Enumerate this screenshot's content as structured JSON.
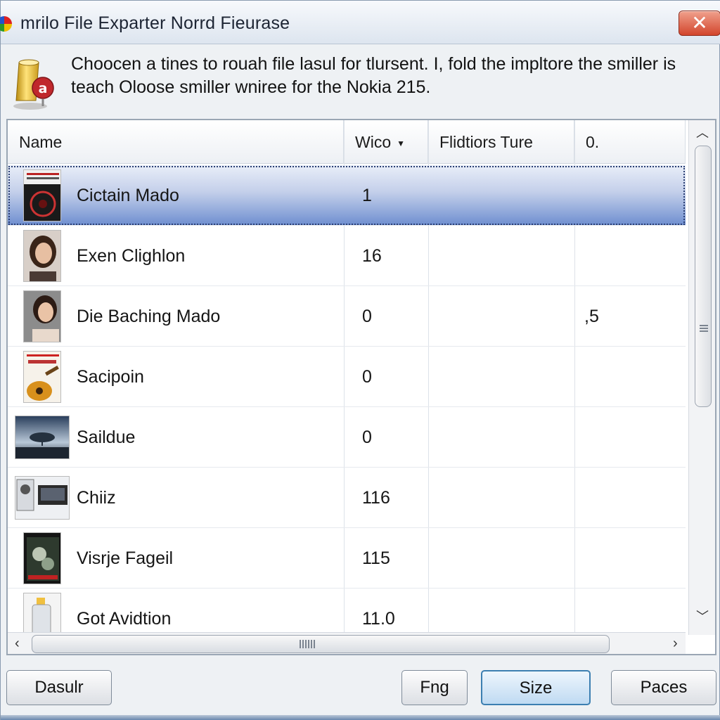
{
  "window": {
    "title": "mrilo File Exparter Norrd Fieurase",
    "close_glyph": "✕"
  },
  "message": {
    "text": "Choocen a tines to rouah file lasul for tlursent. I, fold the impltore the smiller is teach Oloose smiller wniree for the Nokia 215."
  },
  "list": {
    "columns": [
      "Name",
      "Wico",
      "Flidtiors Ture",
      "0."
    ],
    "sorted_column_indicator": "▼",
    "rows": [
      {
        "name": "Cictain Mado",
        "count": "1",
        "ratio": "",
        "selected": true,
        "thumb": "album-cover-dark"
      },
      {
        "name": "Exen Clighlon",
        "count": "16",
        "ratio": "",
        "selected": false,
        "thumb": "portrait-woman"
      },
      {
        "name": "Die Baching Mado",
        "count": "0",
        "ratio": ",5",
        "selected": false,
        "thumb": "portrait-woman-2"
      },
      {
        "name": "Sacipoin",
        "count": "0",
        "ratio": "",
        "selected": false,
        "thumb": "guitar-poster"
      },
      {
        "name": "Saildue",
        "count": "0",
        "ratio": "",
        "selected": false,
        "thumb": "landscape-tree"
      },
      {
        "name": "Chiiz",
        "count": "116",
        "ratio": "",
        "selected": false,
        "thumb": "speakers"
      },
      {
        "name": "Visrje Fageil",
        "count": "115",
        "ratio": "",
        "selected": false,
        "thumb": "movie-poster"
      },
      {
        "name": "Got Avidtion",
        "count": "11.0",
        "ratio": "",
        "selected": false,
        "thumb": "bottle"
      }
    ],
    "scroll_up_glyph": "︿",
    "scroll_down_glyph": "﹀",
    "scroll_left_glyph": "‹",
    "scroll_right_glyph": "›"
  },
  "buttons": {
    "left": "Dasulr",
    "b1": "Fng",
    "b2": "Size",
    "b3": "Paces"
  },
  "colors": {
    "selection": "#6f8fd0",
    "close_button": "#d2452c",
    "default_button_border": "#3c7fb1"
  }
}
